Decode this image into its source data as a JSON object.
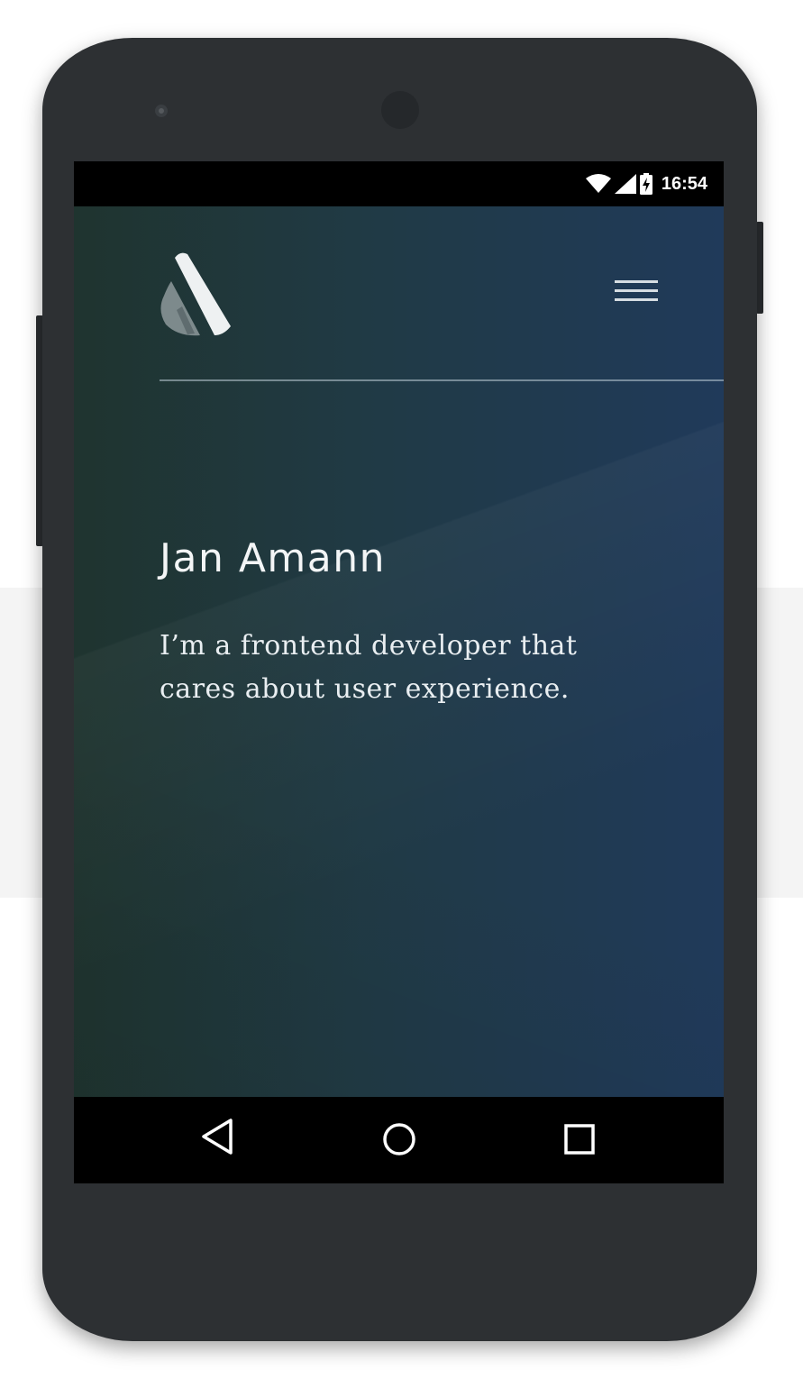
{
  "status_bar": {
    "time": "16:54",
    "icons": [
      "wifi-icon",
      "signal-icon",
      "battery-charging-icon"
    ]
  },
  "header": {
    "logo": "logo-icon",
    "menu_icon": "hamburger-menu-icon"
  },
  "hero": {
    "name": "Jan Amann",
    "tagline": "I’m a frontend developer that cares about user experience."
  },
  "nav_bar": {
    "buttons": [
      "back-icon",
      "home-icon",
      "recents-icon"
    ]
  },
  "colors": {
    "device": "#2d3033",
    "background_left": "#1f342f",
    "background_right": "#203a5a",
    "text": "#f3f5f6"
  }
}
